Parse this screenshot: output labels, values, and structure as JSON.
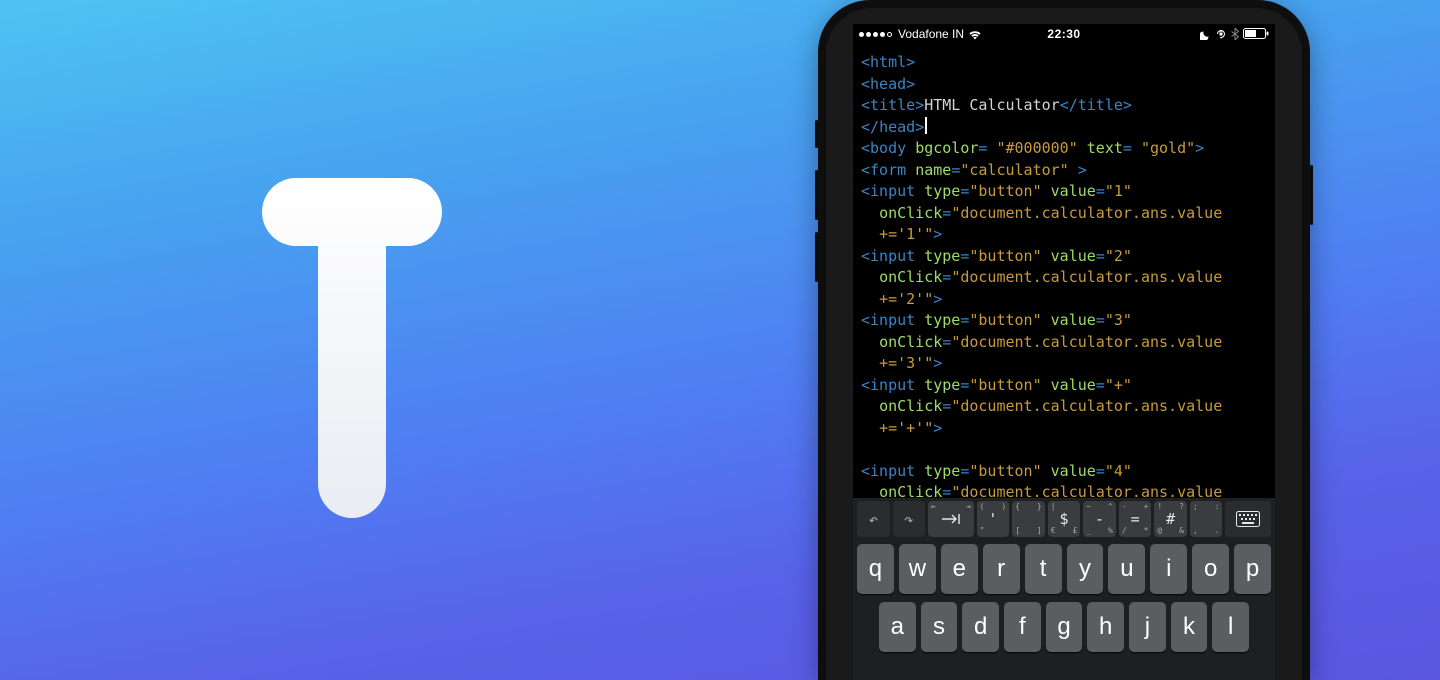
{
  "status_bar": {
    "carrier": "Vodafone IN",
    "time": "22:30"
  },
  "code_lines": [
    [
      {
        "t": "punct",
        "v": "<"
      },
      {
        "t": "tag",
        "v": "html"
      },
      {
        "t": "punct",
        "v": ">"
      }
    ],
    [
      {
        "t": "punct",
        "v": "<"
      },
      {
        "t": "tag",
        "v": "head"
      },
      {
        "t": "punct",
        "v": ">"
      }
    ],
    [
      {
        "t": "punct",
        "v": "<"
      },
      {
        "t": "tag",
        "v": "title"
      },
      {
        "t": "punct",
        "v": ">"
      },
      {
        "t": "text",
        "v": "HTML Calculator"
      },
      {
        "t": "punct",
        "v": "</"
      },
      {
        "t": "tag",
        "v": "title"
      },
      {
        "t": "punct",
        "v": ">"
      }
    ],
    [
      {
        "t": "punct",
        "v": "</"
      },
      {
        "t": "tag",
        "v": "head"
      },
      {
        "t": "punct",
        "v": ">"
      },
      {
        "t": "cursor"
      }
    ],
    [
      {
        "t": "punct",
        "v": "<"
      },
      {
        "t": "tag",
        "v": "body"
      },
      {
        "t": "text",
        "v": " "
      },
      {
        "t": "attr",
        "v": "bgcolor"
      },
      {
        "t": "eq",
        "v": "= "
      },
      {
        "t": "str",
        "v": "\"#000000\""
      },
      {
        "t": "text",
        "v": " "
      },
      {
        "t": "attr",
        "v": "text"
      },
      {
        "t": "eq",
        "v": "= "
      },
      {
        "t": "str",
        "v": "\"gold\""
      },
      {
        "t": "punct",
        "v": ">"
      }
    ],
    [
      {
        "t": "punct",
        "v": "<"
      },
      {
        "t": "tag",
        "v": "form"
      },
      {
        "t": "text",
        "v": " "
      },
      {
        "t": "attr",
        "v": "name"
      },
      {
        "t": "eq",
        "v": "="
      },
      {
        "t": "str",
        "v": "\"calculator\""
      },
      {
        "t": "text",
        "v": " "
      },
      {
        "t": "punct",
        "v": ">"
      }
    ],
    [
      {
        "t": "punct",
        "v": "<"
      },
      {
        "t": "tag",
        "v": "input"
      },
      {
        "t": "text",
        "v": " "
      },
      {
        "t": "attr",
        "v": "type"
      },
      {
        "t": "eq",
        "v": "="
      },
      {
        "t": "str",
        "v": "\"button\""
      },
      {
        "t": "text",
        "v": " "
      },
      {
        "t": "attr",
        "v": "value"
      },
      {
        "t": "eq",
        "v": "="
      },
      {
        "t": "str",
        "v": "\"1\""
      }
    ],
    [
      {
        "t": "text",
        "v": "  "
      },
      {
        "t": "attr",
        "v": "onClick"
      },
      {
        "t": "eq",
        "v": "="
      },
      {
        "t": "str",
        "v": "\"document.calculator.ans.value"
      }
    ],
    [
      {
        "t": "text",
        "v": "  "
      },
      {
        "t": "str",
        "v": "+='1'\""
      },
      {
        "t": "punct",
        "v": ">"
      }
    ],
    [
      {
        "t": "punct",
        "v": "<"
      },
      {
        "t": "tag",
        "v": "input"
      },
      {
        "t": "text",
        "v": " "
      },
      {
        "t": "attr",
        "v": "type"
      },
      {
        "t": "eq",
        "v": "="
      },
      {
        "t": "str",
        "v": "\"button\""
      },
      {
        "t": "text",
        "v": " "
      },
      {
        "t": "attr",
        "v": "value"
      },
      {
        "t": "eq",
        "v": "="
      },
      {
        "t": "str",
        "v": "\"2\""
      }
    ],
    [
      {
        "t": "text",
        "v": "  "
      },
      {
        "t": "attr",
        "v": "onClick"
      },
      {
        "t": "eq",
        "v": "="
      },
      {
        "t": "str",
        "v": "\"document.calculator.ans.value"
      }
    ],
    [
      {
        "t": "text",
        "v": "  "
      },
      {
        "t": "str",
        "v": "+='2'\""
      },
      {
        "t": "punct",
        "v": ">"
      }
    ],
    [
      {
        "t": "punct",
        "v": "<"
      },
      {
        "t": "tag",
        "v": "input"
      },
      {
        "t": "text",
        "v": " "
      },
      {
        "t": "attr",
        "v": "type"
      },
      {
        "t": "eq",
        "v": "="
      },
      {
        "t": "str",
        "v": "\"button\""
      },
      {
        "t": "text",
        "v": " "
      },
      {
        "t": "attr",
        "v": "value"
      },
      {
        "t": "eq",
        "v": "="
      },
      {
        "t": "str",
        "v": "\"3\""
      }
    ],
    [
      {
        "t": "text",
        "v": "  "
      },
      {
        "t": "attr",
        "v": "onClick"
      },
      {
        "t": "eq",
        "v": "="
      },
      {
        "t": "str",
        "v": "\"document.calculator.ans.value"
      }
    ],
    [
      {
        "t": "text",
        "v": "  "
      },
      {
        "t": "str",
        "v": "+='3'\""
      },
      {
        "t": "punct",
        "v": ">"
      }
    ],
    [
      {
        "t": "punct",
        "v": "<"
      },
      {
        "t": "tag",
        "v": "input"
      },
      {
        "t": "text",
        "v": " "
      },
      {
        "t": "attr",
        "v": "type"
      },
      {
        "t": "eq",
        "v": "="
      },
      {
        "t": "str",
        "v": "\"button\""
      },
      {
        "t": "text",
        "v": " "
      },
      {
        "t": "attr",
        "v": "value"
      },
      {
        "t": "eq",
        "v": "="
      },
      {
        "t": "str",
        "v": "\"+\""
      }
    ],
    [
      {
        "t": "text",
        "v": "  "
      },
      {
        "t": "attr",
        "v": "onClick"
      },
      {
        "t": "eq",
        "v": "="
      },
      {
        "t": "str",
        "v": "\"document.calculator.ans.value"
      }
    ],
    [
      {
        "t": "text",
        "v": "  "
      },
      {
        "t": "str",
        "v": "+='+'\""
      },
      {
        "t": "punct",
        "v": ">"
      }
    ],
    [],
    [
      {
        "t": "punct",
        "v": "<"
      },
      {
        "t": "tag",
        "v": "input"
      },
      {
        "t": "text",
        "v": " "
      },
      {
        "t": "attr",
        "v": "type"
      },
      {
        "t": "eq",
        "v": "="
      },
      {
        "t": "str",
        "v": "\"button\""
      },
      {
        "t": "text",
        "v": " "
      },
      {
        "t": "attr",
        "v": "value"
      },
      {
        "t": "eq",
        "v": "="
      },
      {
        "t": "str",
        "v": "\"4\""
      }
    ],
    [
      {
        "t": "text",
        "v": "  "
      },
      {
        "t": "attr",
        "v": "onClick"
      },
      {
        "t": "eq",
        "v": "="
      },
      {
        "t": "str",
        "v": "\"document.calculator.ans.value"
      }
    ]
  ],
  "accessory_keys": [
    {
      "type": "undo"
    },
    {
      "type": "redo"
    },
    {
      "type": "tab"
    },
    {
      "type": "sym",
      "center": "'",
      "tl": "(",
      "tr": ")",
      "bl": "\"",
      "br": ""
    },
    {
      "type": "sym",
      "center": "",
      "tl": "{",
      "tr": "}",
      "bl": "[",
      "br": "]"
    },
    {
      "type": "sym",
      "center": "$",
      "tl": "|",
      "tr": "",
      "bl": "€",
      "br": "£"
    },
    {
      "type": "sym",
      "center": "-",
      "tl": "~",
      "tr": "^",
      "bl": "_",
      "br": "%"
    },
    {
      "type": "sym",
      "center": "=",
      "tl": "-",
      "tr": "+",
      "bl": "/",
      "br": "*"
    },
    {
      "type": "sym",
      "center": "#",
      "tl": "!",
      "tr": "?",
      "bl": "@",
      "br": "&"
    },
    {
      "type": "sym",
      "center": "",
      "tl": ";",
      "tr": ":",
      "bl": ",",
      "br": "."
    },
    {
      "type": "kbicon"
    }
  ],
  "keyboard_rows": [
    [
      "q",
      "w",
      "e",
      "r",
      "t",
      "y",
      "u",
      "i",
      "o",
      "p"
    ],
    [
      "a",
      "s",
      "d",
      "f",
      "g",
      "h",
      "j",
      "k",
      "l"
    ]
  ]
}
